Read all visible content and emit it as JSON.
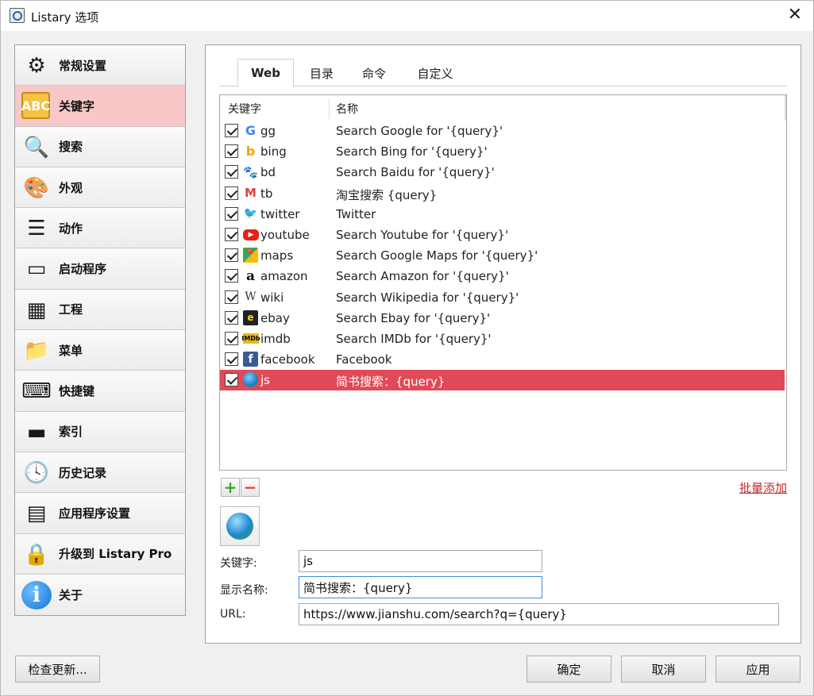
{
  "window": {
    "title": "Listary 选项",
    "close_glyph": "✕"
  },
  "sidebar": {
    "items": [
      {
        "label": "常规设置",
        "icon": "gear-icon",
        "glyph": "⚙"
      },
      {
        "label": "关键字",
        "icon": "abc-icon",
        "glyph": "ABC",
        "active": true
      },
      {
        "label": "搜索",
        "icon": "magnifier-icon",
        "glyph": "🔍"
      },
      {
        "label": "外观",
        "icon": "palette-icon",
        "glyph": "🎨"
      },
      {
        "label": "动作",
        "icon": "action-list-icon",
        "glyph": "☰"
      },
      {
        "label": "启动程序",
        "icon": "windows-icon",
        "glyph": "▭"
      },
      {
        "label": "工程",
        "icon": "cubes-icon",
        "glyph": "▦"
      },
      {
        "label": "菜单",
        "icon": "folder-heart-icon",
        "glyph": "📁"
      },
      {
        "label": "快捷键",
        "icon": "keyboard-icon",
        "glyph": "⌨"
      },
      {
        "label": "索引",
        "icon": "drive-icon",
        "glyph": "▬"
      },
      {
        "label": "历史记录",
        "icon": "history-clock-icon",
        "glyph": "🕓"
      },
      {
        "label": "应用程序设置",
        "icon": "app-settings-icon",
        "glyph": "▤"
      },
      {
        "label": "升级到 Listary Pro",
        "icon": "lock-pencil-icon",
        "glyph": "🔒"
      },
      {
        "label": "关于",
        "icon": "info-icon",
        "glyph": "i"
      }
    ]
  },
  "tabs": [
    {
      "label": "Web",
      "active": true
    },
    {
      "label": "目录"
    },
    {
      "label": "命令"
    },
    {
      "label": "自定义"
    }
  ],
  "list": {
    "col_keyword": "关键字",
    "col_name": "名称",
    "rows": [
      {
        "keyword": "gg",
        "name": "Search Google for '{query}'",
        "icon": "google-icon",
        "glyph": "G",
        "checked": true
      },
      {
        "keyword": "bing",
        "name": "Search Bing for '{query}'",
        "icon": "bing-icon",
        "glyph": "b",
        "checked": true
      },
      {
        "keyword": "bd",
        "name": "Search Baidu for '{query}'",
        "icon": "baidu-paw-icon",
        "glyph": "🐾",
        "checked": true
      },
      {
        "keyword": "tb",
        "name": "淘宝搜索 {query}",
        "icon": "taobao-icon",
        "glyph": "M",
        "checked": true
      },
      {
        "keyword": "twitter",
        "name": "Twitter",
        "icon": "twitter-bird-icon",
        "glyph": "🐦",
        "checked": true
      },
      {
        "keyword": "youtube",
        "name": "Search Youtube for '{query}'",
        "icon": "youtube-icon",
        "glyph": "▶",
        "checked": true
      },
      {
        "keyword": "maps",
        "name": "Search Google Maps for '{query}'",
        "icon": "google-maps-icon",
        "glyph": "📍",
        "checked": true
      },
      {
        "keyword": "amazon",
        "name": "Search Amazon for '{query}'",
        "icon": "amazon-icon",
        "glyph": "a",
        "checked": true
      },
      {
        "keyword": "wiki",
        "name": "Search Wikipedia for '{query}'",
        "icon": "wikipedia-icon",
        "glyph": "W",
        "checked": true
      },
      {
        "keyword": "ebay",
        "name": "Search Ebay for '{query}'",
        "icon": "ebay-bag-icon",
        "glyph": "e",
        "checked": true
      },
      {
        "keyword": "imdb",
        "name": "Search IMDb for '{query}'",
        "icon": "imdb-icon",
        "glyph": "IMDb",
        "checked": true
      },
      {
        "keyword": "facebook",
        "name": "Facebook",
        "icon": "facebook-icon",
        "glyph": "f",
        "checked": true
      },
      {
        "keyword": "js",
        "name": "简书搜索：{query}",
        "icon": "globe-link-icon",
        "glyph": "",
        "checked": true,
        "selected": true
      }
    ]
  },
  "toolbar": {
    "add_glyph": "+",
    "remove_glyph": "−",
    "batch_add": "批量添加"
  },
  "form": {
    "keyword_label": "关键字:",
    "keyword_value": "js",
    "display_name_label": "显示名称:",
    "display_name_value": "简书搜索：{query}",
    "url_label": "URL:",
    "url_value": "https://www.jianshu.com/search?q={query}"
  },
  "buttons": {
    "check_update": "检查更新...",
    "ok": "确定",
    "cancel": "取消",
    "apply": "应用"
  },
  "colors": {
    "selected_row": "#e04a57",
    "active_nav": "#f8c8c8",
    "batch_link": "#c12a2a"
  }
}
